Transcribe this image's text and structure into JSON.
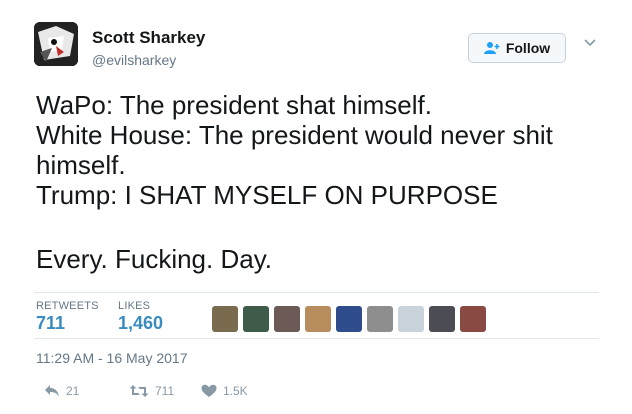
{
  "user": {
    "name": "Scott Sharkey",
    "handle": "@evilsharkey"
  },
  "follow_button": {
    "label": "Follow"
  },
  "tweet": {
    "lines": [
      "WaPo: The president shat himself.",
      "White House: The president would never shit",
      "himself.",
      "Trump: I SHAT MYSELF ON PURPOSE",
      "Every. Fucking. Day."
    ]
  },
  "stats": {
    "retweets_label": "RETWEETS",
    "retweets_value": "711",
    "likes_label": "LIKES",
    "likes_value": "1,460"
  },
  "timestamp": "11:29 AM - 16 May 2017",
  "actions": {
    "reply_count": "21",
    "retweet_count": "711",
    "like_count": "1.5K"
  },
  "colors": {
    "accent": "#3a8bbf",
    "muted": "#657786",
    "text": "#14171a"
  }
}
